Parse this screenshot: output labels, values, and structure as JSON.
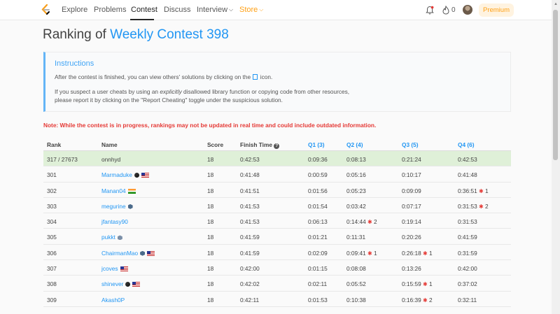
{
  "nav": {
    "items": [
      {
        "label": "Explore"
      },
      {
        "label": "Problems"
      },
      {
        "label": "Contest"
      },
      {
        "label": "Discuss"
      },
      {
        "label": "Interview"
      },
      {
        "label": "Store"
      }
    ],
    "fire_count": "0",
    "premium_label": "Premium",
    "icons": [
      "leetcode-logo-icon",
      "bell-icon",
      "fire-icon",
      "avatar"
    ],
    "colors": {
      "accent": "#ffa116",
      "link": "#2196f3"
    }
  },
  "page": {
    "title_prefix": "Ranking of",
    "contest_name": "Weekly Contest 398"
  },
  "instructions": {
    "title": "Instructions",
    "line1_pre": "After the contest is finished, you can view others' solutions by clicking on the",
    "line1_post": "icon.",
    "line2_pre": "If you suspect a user cheats by using an",
    "line2_em": "explicitly",
    "line2_post": "disallowed library function or copying code from other resources,",
    "line3": "please report it by clicking on the \"Report Cheating\" toggle under the suspicious solution."
  },
  "note": "Note: While the contest is in progress, rankings may not be updated in real time and could include outdated information.",
  "table": {
    "headers": {
      "rank": "Rank",
      "name": "Name",
      "score": "Score",
      "finish": "Finish Time",
      "q1": "Q1 (3)",
      "q2": "Q2 (4)",
      "q3": "Q3 (5)",
      "q4": "Q4 (6)"
    },
    "rows": [
      {
        "rank": "317 / 27673",
        "name": "onnhyd",
        "score": "18",
        "finish": "0:42:53",
        "q1": "0:09:36",
        "q2": "0:08:13",
        "q3": "0:21:24",
        "q4": "0:42:53"
      },
      {
        "rank": "301",
        "name": "Marmaduke",
        "score": "18",
        "finish": "0:41:48",
        "q1": "0:00:59",
        "q2": "0:05:16",
        "q3": "0:10:17",
        "q4": "0:41:48"
      },
      {
        "rank": "302",
        "name": "Manan04",
        "score": "18",
        "finish": "0:41:51",
        "q1": "0:01:56",
        "q2": "0:05:23",
        "q3": "0:09:09",
        "q4": "0:36:51",
        "q4_wrong": "1"
      },
      {
        "rank": "303",
        "name": "megurine",
        "score": "18",
        "finish": "0:41:53",
        "q1": "0:01:54",
        "q2": "0:03:42",
        "q3": "0:07:17",
        "q4": "0:31:53",
        "q4_wrong": "2"
      },
      {
        "rank": "304",
        "name": "jfantasy90",
        "score": "18",
        "finish": "0:41:53",
        "q1": "0:06:13",
        "q2": "0:14:44",
        "q2_wrong": "2",
        "q3": "0:19:14",
        "q4": "0:31:53"
      },
      {
        "rank": "305",
        "name": "pukkt",
        "score": "18",
        "finish": "0:41:59",
        "q1": "0:01:21",
        "q2": "0:11:31",
        "q3": "0:20:26",
        "q4": "0:41:59"
      },
      {
        "rank": "306",
        "name": "ChairmanMao",
        "score": "18",
        "finish": "0:41:59",
        "q1": "0:02:09",
        "q2": "0:09:41",
        "q2_wrong": "1",
        "q3": "0:26:18",
        "q3_wrong": "1",
        "q4": "0:31:59"
      },
      {
        "rank": "307",
        "name": "jcoves",
        "score": "18",
        "finish": "0:42:00",
        "q1": "0:01:15",
        "q2": "0:08:08",
        "q3": "0:13:26",
        "q4": "0:42:00"
      },
      {
        "rank": "308",
        "name": "shinever",
        "score": "18",
        "finish": "0:42:02",
        "q1": "0:02:11",
        "q2": "0:05:52",
        "q3": "0:15:59",
        "q3_wrong": "1",
        "q4": "0:37:02"
      },
      {
        "rank": "309",
        "name": "Akash0P",
        "score": "18",
        "finish": "0:42:11",
        "q1": "0:01:53",
        "q2": "0:10:38",
        "q3": "0:16:39",
        "q3_wrong": "2",
        "q4": "0:32:11"
      }
    ]
  }
}
